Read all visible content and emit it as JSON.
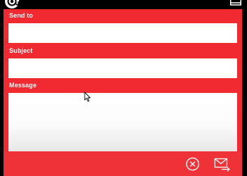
{
  "form": {
    "send_to": {
      "label": "Send to",
      "value": "",
      "placeholder": ""
    },
    "subject": {
      "label": "Subject",
      "value": "",
      "placeholder": ""
    },
    "message": {
      "label": "Message",
      "value": "",
      "placeholder": ""
    }
  },
  "icons": {
    "app_logo": "at-sign-icon",
    "window_control": "window-control-icon",
    "cancel": "close-circle-icon",
    "send": "envelope-send-icon",
    "pointer": "mouse-cursor-icon"
  },
  "colors": {
    "panel": "#f02a30",
    "footer": "#ee3237",
    "field_background": "#ffffff",
    "label_text": "#ffffff",
    "title_bar": "#000000"
  }
}
